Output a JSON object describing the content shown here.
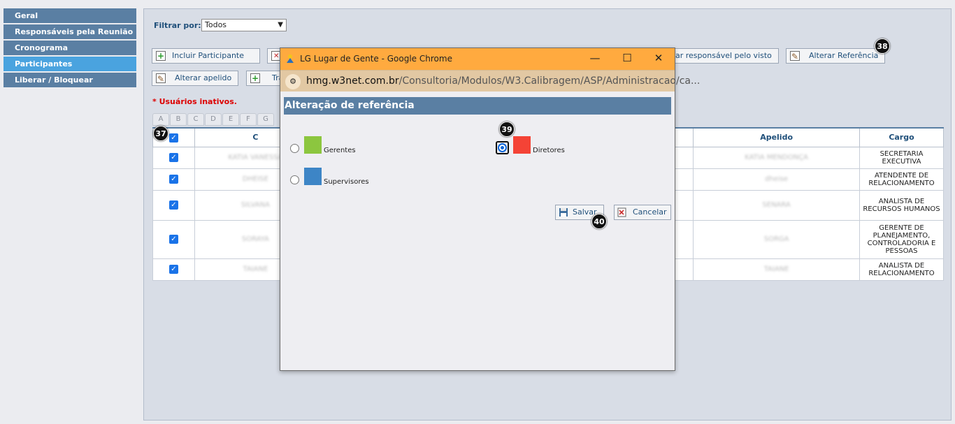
{
  "sidebar": {
    "items": [
      {
        "label": "Geral",
        "active": false
      },
      {
        "label": "Responsáveis pela Reunião",
        "active": false
      },
      {
        "label": "Cronograma",
        "active": false
      },
      {
        "label": "Participantes",
        "active": true
      },
      {
        "label": "Liberar / Bloquear",
        "active": false
      }
    ]
  },
  "filter": {
    "label": "Filtrar por:",
    "value": "Todos"
  },
  "toolbar": {
    "include_label": "Incluir Participante",
    "change_responsible_label": "ar responsável pelo visto",
    "change_reference_label": "Alterar Referência",
    "change_nickname_label": "Alterar apelido",
    "truncated_label": "Tra"
  },
  "inactive_note": "* Usuários inativos.",
  "letters": [
    "A",
    "B",
    "C",
    "D",
    "E",
    "F",
    "G"
  ],
  "table": {
    "headers": {
      "name_partial": "C",
      "apelido": "Apelido",
      "cargo": "Cargo"
    },
    "rows": [
      {
        "name": "KATIA VANESSA",
        "apelido": "KATIA MENDONÇA",
        "cargo": "SECRETARIA EXECUTIVA"
      },
      {
        "name": "DHEISE",
        "apelido": "dheise",
        "cargo": "ATENDENTE DE RELACIONAMENTO"
      },
      {
        "name": "SILVANA",
        "apelido": "SENARA",
        "cargo": "ANALISTA DE RECURSOS HUMANOS"
      },
      {
        "name": "SORAYA",
        "apelido": "SORGA",
        "cargo": "GERENTE DE PLANEJAMENTO, CONTROLADORIA E PESSOAS"
      },
      {
        "name": "TAIANE",
        "apelido": "TAIANE",
        "cargo": "ANALISTA DE RELACIONAMENTO"
      }
    ]
  },
  "badges": {
    "b37": "37",
    "b38": "38",
    "b39": "39",
    "b40": "40"
  },
  "popup": {
    "window_title": "LG Lugar de Gente - Google Chrome",
    "url_host": "hmg.w3net.com.br",
    "url_path": "/Consultoria/Modulos/W3.Calibragem/ASP/Administracao/ca...",
    "header": "Alteração de referência",
    "options": [
      {
        "label": "Gerentes",
        "color": "#8cc63f",
        "selected": false
      },
      {
        "label": "Diretores",
        "color": "#f44336",
        "selected": true
      },
      {
        "label": "Supervisores",
        "color": "#3d85c6",
        "selected": false
      }
    ],
    "save_label": "Salvar",
    "cancel_label": "Cancelar"
  },
  "colors": {
    "accent": "#5a7fa3",
    "active": "#4aa3df",
    "titlebar": "#ffaa3f"
  }
}
